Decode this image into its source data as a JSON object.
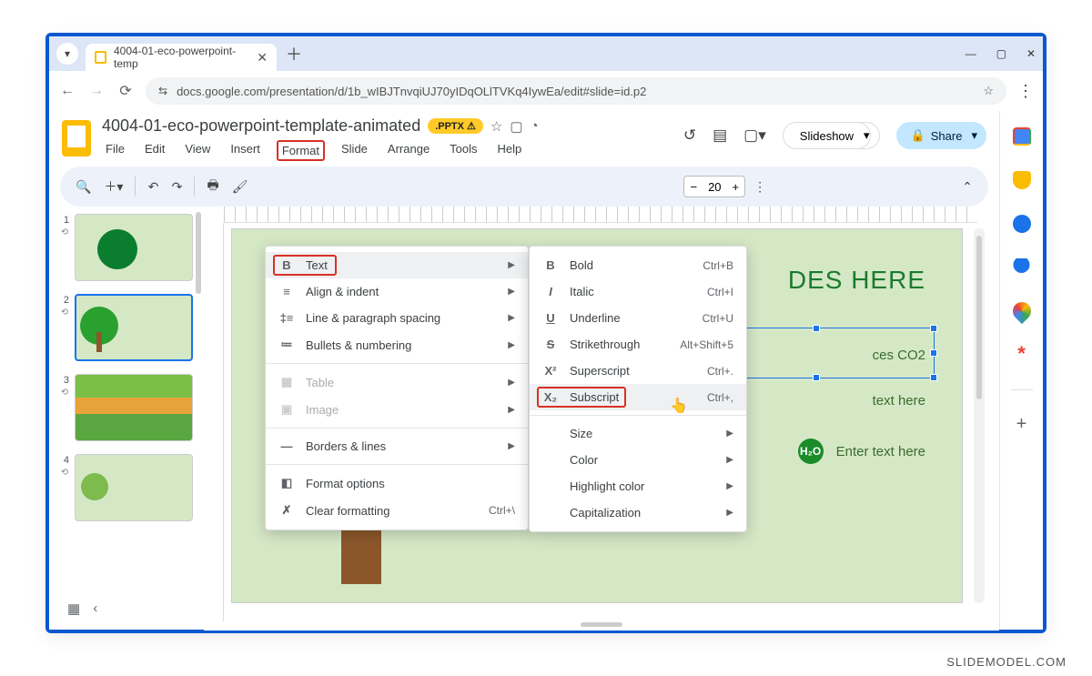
{
  "browser": {
    "tab_title": "4004-01-eco-powerpoint-temp",
    "url": "docs.google.com/presentation/d/1b_wIBJTnvqiUJ70yIDqOLlTVKq4IywEa/edit#slide=id.p2",
    "win_min": "—",
    "win_max": "▢",
    "win_close": "✕"
  },
  "doc": {
    "title": "4004-01-eco-powerpoint-template-animated",
    "badge": ".PPTX ⚠",
    "menu": {
      "file": "File",
      "edit": "Edit",
      "view": "View",
      "insert": "Insert",
      "format": "Format",
      "slide": "Slide",
      "arrange": "Arrange",
      "tools": "Tools",
      "help": "Help"
    }
  },
  "header": {
    "slideshow": "Slideshow",
    "share": "Share"
  },
  "toolbar": {
    "font_size": "20"
  },
  "menu1": {
    "text": "Text",
    "align": "Align & indent",
    "spacing": "Line & paragraph spacing",
    "bullets": "Bullets & numbering",
    "table": "Table",
    "image": "Image",
    "borders": "Borders & lines",
    "options": "Format options",
    "clear": "Clear formatting",
    "clear_sc": "Ctrl+\\"
  },
  "menu2": {
    "bold": {
      "label": "Bold",
      "sc": "Ctrl+B"
    },
    "italic": {
      "label": "Italic",
      "sc": "Ctrl+I"
    },
    "underline": {
      "label": "Underline",
      "sc": "Ctrl+U"
    },
    "strike": {
      "label": "Strikethrough",
      "sc": "Alt+Shift+5"
    },
    "superscript": {
      "label": "Superscript",
      "sc": "Ctrl+."
    },
    "subscript": {
      "label": "Subscript",
      "sc": "Ctrl+,"
    },
    "size": "Size",
    "color": "Color",
    "highlight": "Highlight color",
    "caps": "Capitalization"
  },
  "slide": {
    "co2": "O₂",
    "title": "DES HERE",
    "b1": "ces CO2",
    "b2": "text here",
    "b3": "Enter text here",
    "h2o": "H₂O"
  },
  "thumbs": {
    "1": "1",
    "2": "2",
    "3": "3",
    "4": "4"
  },
  "footer": "SLIDEMODEL.COM"
}
